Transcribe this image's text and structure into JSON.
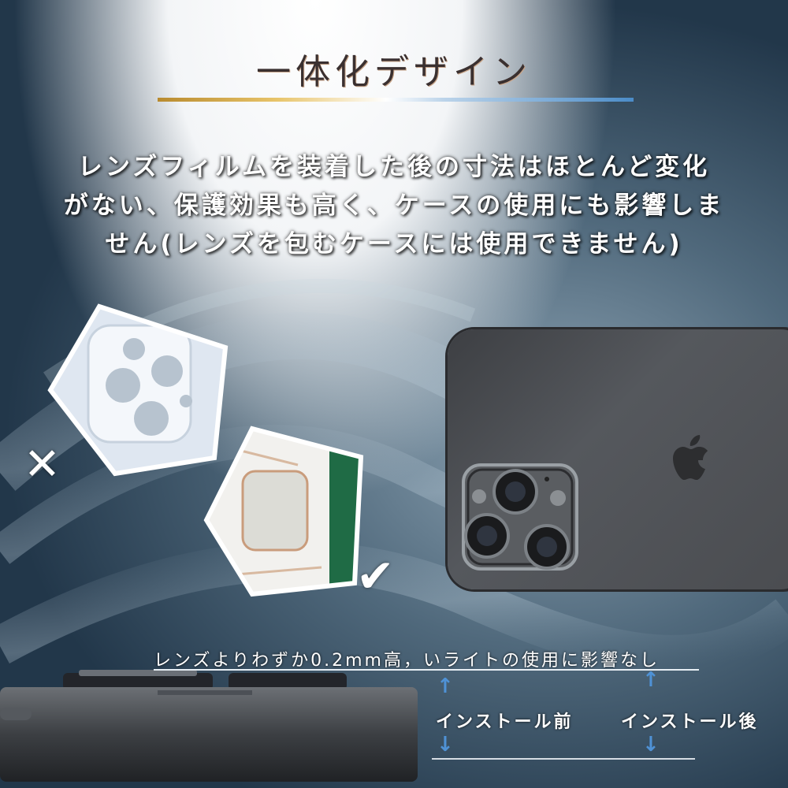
{
  "title": "一体化デザイン",
  "description_lines": [
    "レンズフィルムを装着した後の寸法はほとんど変化",
    "がない、保護効果も高く、ケースの使用にも影響しま",
    "せん(レンズを包むケースには使用できません)"
  ],
  "marks": {
    "ng": "✕",
    "ok": "✔"
  },
  "note": "レンズよりわずか0.2mm高，いライトの使用に影響なし",
  "labels": {
    "before": "インストール前",
    "after": "インストール後"
  },
  "arrows": {
    "up": "↑",
    "down": "↓"
  },
  "colors": {
    "gold": "#c9a24a",
    "blue": "#4b8cc8",
    "arrow": "#4f92d6",
    "case_green": "#1f6b45"
  }
}
